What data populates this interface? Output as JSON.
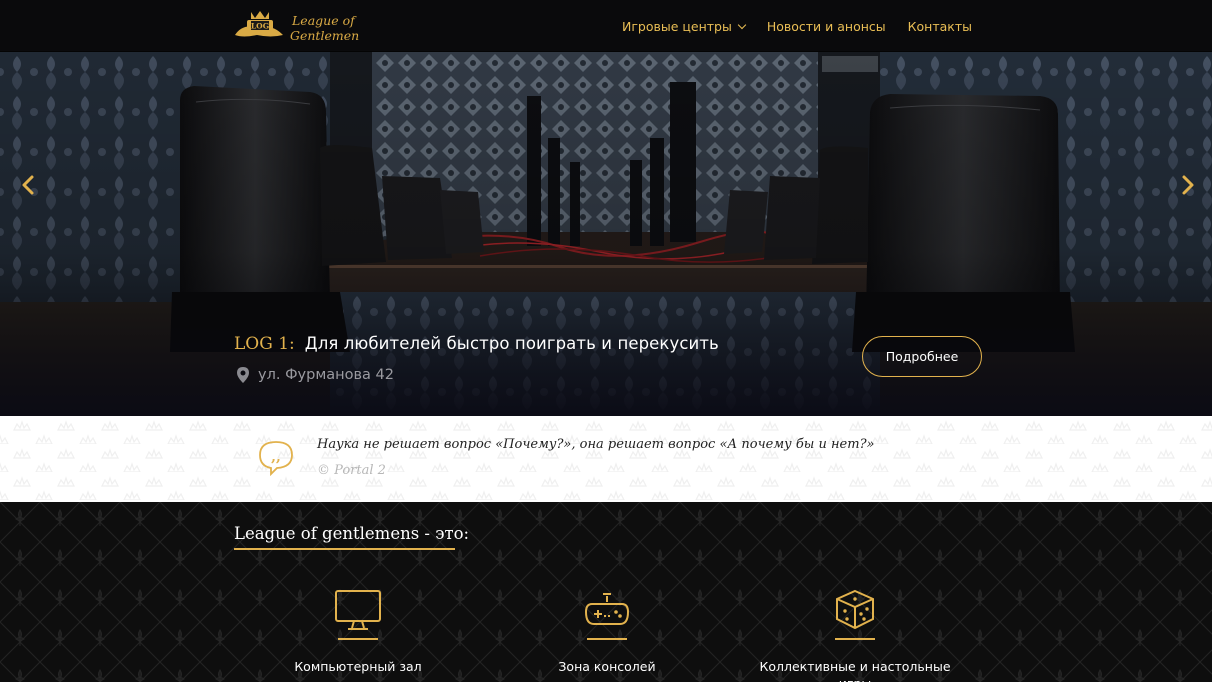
{
  "header": {
    "logo_text": [
      "League of",
      "Gentlemen"
    ],
    "logo_badge": "LOG",
    "nav": [
      {
        "label": "Игровые центры",
        "has_dropdown": true
      },
      {
        "label": "Новости и анонсы",
        "has_dropdown": false
      },
      {
        "label": "Контакты",
        "has_dropdown": false
      }
    ]
  },
  "hero": {
    "code": "LOG 1:",
    "description": "Для любителей быстро поиграть и перекусить",
    "address": "ул. Фурманова 42",
    "button_label": "Подробнее",
    "icons": {
      "prev": "chevron-left-icon",
      "next": "chevron-right-icon",
      "pin": "map-pin-icon"
    }
  },
  "quote": {
    "text": "Наука не решает вопрос «Почему?», она решает вопрос «А почему бы и нет?»",
    "source": "© Portal 2",
    "icon": "quote-bubble-icon"
  },
  "features": {
    "title": "League of gentlemens - это:",
    "items": [
      {
        "label": "Компьютерный зал",
        "icon": "monitor-icon"
      },
      {
        "label": "Зона консолей",
        "icon": "gamepad-icon"
      },
      {
        "label": "Коллективные и настольные игры",
        "icon": "dice-icon"
      }
    ]
  },
  "colors": {
    "accent": "#e2b24d",
    "dark": "#0e0e0e",
    "light": "#ffffff"
  }
}
